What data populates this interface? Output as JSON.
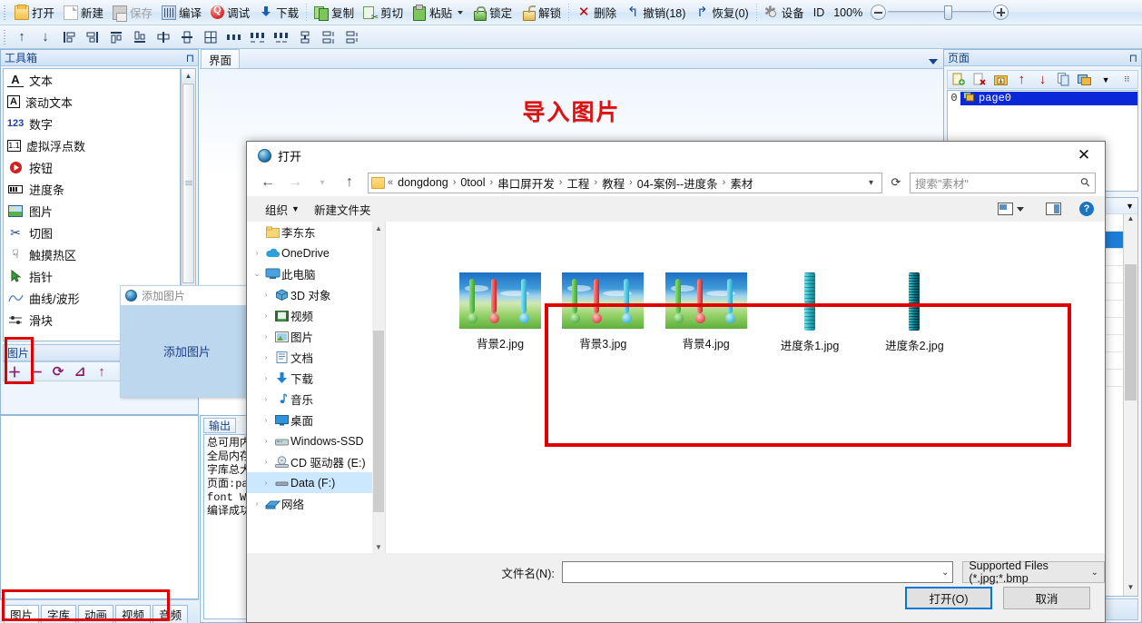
{
  "toolbar": {
    "buttons": [
      {
        "label": "打开",
        "icon": "open-folder-icon",
        "disabled": false
      },
      {
        "label": "新建",
        "icon": "new-file-icon",
        "disabled": false
      },
      {
        "label": "保存",
        "icon": "save-disk-icon",
        "disabled": true
      },
      {
        "label": "编译",
        "icon": "compile-icon",
        "disabled": false
      },
      {
        "label": "调试",
        "icon": "debug-icon",
        "disabled": false
      },
      {
        "label": "下载",
        "icon": "download-icon",
        "disabled": false
      }
    ],
    "buttons2": [
      {
        "label": "复制",
        "icon": "copy-icon"
      },
      {
        "label": "剪切",
        "icon": "cut-icon"
      },
      {
        "label": "粘贴",
        "icon": "paste-icon"
      },
      {
        "label": "锁定",
        "icon": "lock-icon"
      },
      {
        "label": "解锁",
        "icon": "unlock-icon"
      }
    ],
    "buttons3": [
      {
        "label": "删除",
        "icon": "delete-x-icon"
      },
      {
        "label": "撤销(18)",
        "icon": "undo-icon"
      },
      {
        "label": "恢复(0)",
        "icon": "redo-icon"
      }
    ],
    "device_label": "设备",
    "id_label": "ID",
    "zoom_label": "100%"
  },
  "align_toolbar": {
    "icons": [
      "align-up-icon",
      "align-down-icon",
      "align-left-icon",
      "align-right-icon",
      "align-top-icon",
      "align-bottom-icon",
      "align-center-h-icon",
      "align-center-v-icon",
      "grid-icon",
      "space-h-icon",
      "space-h-out-icon",
      "space-h-in-icon",
      "same-width-icon",
      "space-v-out-icon",
      "space-v-in-icon"
    ]
  },
  "toolbox": {
    "title": "工具箱",
    "items": [
      {
        "label": "文本",
        "icon": "text-A-icon"
      },
      {
        "label": "滚动文本",
        "icon": "scroll-text-icon"
      },
      {
        "label": "数字",
        "icon": "number-123-icon"
      },
      {
        "label": "虚拟浮点数",
        "icon": "float-icon"
      },
      {
        "label": "按钮",
        "icon": "button-play-icon"
      },
      {
        "label": "进度条",
        "icon": "progressbar-icon"
      },
      {
        "label": "图片",
        "icon": "picture-icon"
      },
      {
        "label": "切图",
        "icon": "scissors-icon"
      },
      {
        "label": "触摸热区",
        "icon": "touch-hand-icon"
      },
      {
        "label": "指针",
        "icon": "pointer-icon"
      },
      {
        "label": "曲线/波形",
        "icon": "waveform-icon"
      },
      {
        "label": "滑块",
        "icon": "slider-icon"
      }
    ],
    "image_section_title": "图片",
    "image_tools": [
      "add-plus-icon",
      "remove-minus-icon",
      "refresh-icon",
      "edit-icon",
      "up-arrow-icon"
    ],
    "bottom_tabs": [
      {
        "label": "图片",
        "active": true
      },
      {
        "label": "字库",
        "active": false
      },
      {
        "label": "动画",
        "active": false
      },
      {
        "label": "视频",
        "active": false
      },
      {
        "label": "音频",
        "active": false
      }
    ]
  },
  "center": {
    "tab_label": "界面",
    "canvas_title": "导入图片"
  },
  "addpic_popup": {
    "title": "添加图片",
    "body": "添加图片",
    "icon": "globe-icon"
  },
  "output": {
    "tab_label": "输出",
    "lines": [
      "总可用内",
      "全局内存",
      "字库总大",
      "页面:pa",
      "font Wr",
      "编译成功"
    ]
  },
  "rightpanel": {
    "title": "页面",
    "tools": [
      "new-page-icon",
      "delete-page-icon",
      "import-page-icon",
      "move-up-icon",
      "move-down-icon",
      "copy-page-icon",
      "page-settings-icon"
    ],
    "pages": [
      {
        "index": "0",
        "name": "page0",
        "icon": "page-icon",
        "selected": true
      }
    ]
  },
  "dialog": {
    "title": "打开",
    "close_icon": "close-icon",
    "nav": {
      "back_icon": "back-arrow-icon",
      "forward_icon": "forward-arrow-icon",
      "recent_icon": "chevron-down-icon",
      "up_icon": "up-arrow-icon"
    },
    "breadcrumb": [
      "dongdong",
      "0tool",
      "串口屏开发",
      "工程",
      "教程",
      "04-案例--进度条",
      "素材"
    ],
    "breadcrumb_prefix": "«",
    "refresh_icon": "refresh-icon",
    "search_placeholder": "搜索\"素材\"",
    "search_icon": "search-icon",
    "commands": {
      "organize": "组织",
      "new_folder": "新建文件夹",
      "view_icon": "view-mode-icon",
      "pane_icon": "preview-pane-icon",
      "help_icon": "help-icon"
    },
    "nav_pane": [
      {
        "label": "李东东",
        "icon": "folder-icon",
        "indent": 1,
        "chev": false,
        "selected": false
      },
      {
        "label": "OneDrive",
        "icon": "onedrive-cloud-icon",
        "indent": 0,
        "chev": true,
        "selected": false
      },
      {
        "label": "此电脑",
        "icon": "this-pc-icon",
        "indent": 0,
        "chev": true,
        "expanded": true,
        "selected": false
      },
      {
        "label": "3D 对象",
        "icon": "3d-objects-icon",
        "indent": 1,
        "chev": true,
        "selected": false
      },
      {
        "label": "视频",
        "icon": "videos-icon",
        "indent": 1,
        "chev": true,
        "selected": false
      },
      {
        "label": "图片",
        "icon": "pictures-icon",
        "indent": 1,
        "chev": true,
        "selected": false
      },
      {
        "label": "文档",
        "icon": "documents-icon",
        "indent": 1,
        "chev": true,
        "selected": false
      },
      {
        "label": "下载",
        "icon": "downloads-icon",
        "indent": 1,
        "chev": true,
        "selected": false
      },
      {
        "label": "音乐",
        "icon": "music-icon",
        "indent": 1,
        "chev": true,
        "selected": false
      },
      {
        "label": "桌面",
        "icon": "desktop-icon",
        "indent": 1,
        "chev": true,
        "selected": false
      },
      {
        "label": "Windows-SSD",
        "icon": "drive-icon",
        "indent": 1,
        "chev": true,
        "selected": false
      },
      {
        "label": "CD 驱动器 (E:)",
        "icon": "cd-drive-icon",
        "indent": 1,
        "chev": true,
        "selected": false
      },
      {
        "label": "Data (F:)",
        "icon": "hdd-icon",
        "indent": 1,
        "chev": true,
        "selected": true
      },
      {
        "label": "网络",
        "icon": "network-icon",
        "indent": 0,
        "chev": true,
        "selected": false
      }
    ],
    "files": [
      {
        "name": "背景2.jpg",
        "kind": "scene"
      },
      {
        "name": "背景3.jpg",
        "kind": "scene"
      },
      {
        "name": "背景4.jpg",
        "kind": "scene"
      },
      {
        "name": "进度条1.jpg",
        "kind": "bar",
        "color": "#39c4cf"
      },
      {
        "name": "进度条2.jpg",
        "kind": "bar",
        "color": "#1f8d9e"
      }
    ],
    "footer": {
      "filename_label": "文件名(N):",
      "filename_value": "",
      "filter_value": "Supported Files (*.jpg;*.bmp",
      "open_button": "打开(O)",
      "cancel_button": "取消"
    }
  },
  "colors": {
    "accent_red": "#e00000",
    "title_blue": "#15428b",
    "highlight_blue": "#0a28d8"
  }
}
